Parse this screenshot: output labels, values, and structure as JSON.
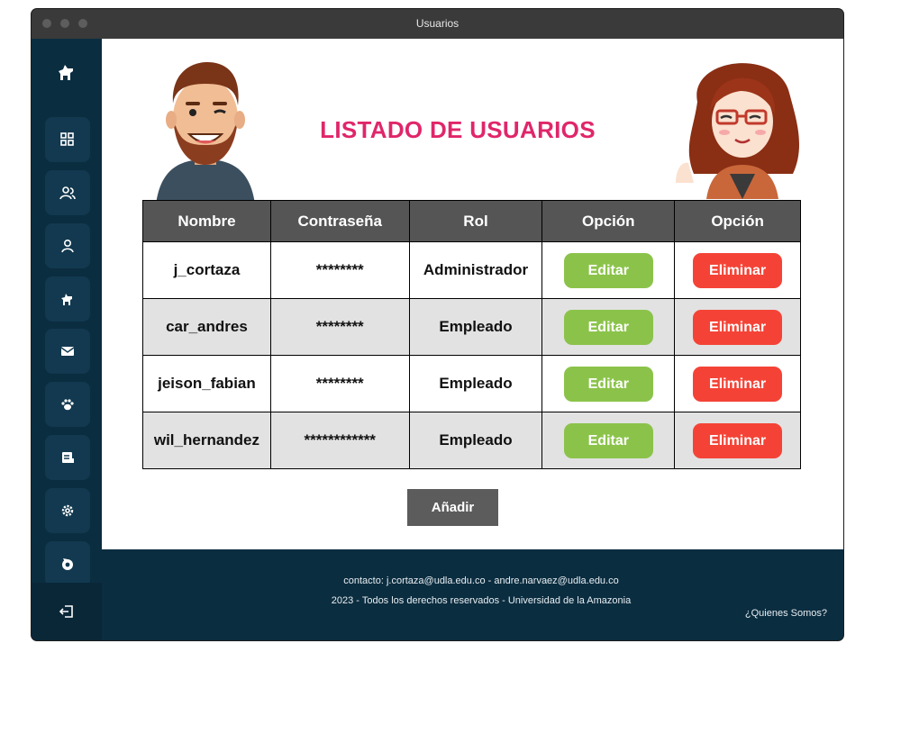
{
  "window": {
    "title": "Usuarios"
  },
  "page": {
    "title": "LISTADO DE USUARIOS"
  },
  "table": {
    "headers": [
      "Nombre",
      "Contraseña",
      "Rol",
      "Opción",
      "Opción"
    ],
    "rows": [
      {
        "name": "j_cortaza",
        "password": "********",
        "role": "Administrador"
      },
      {
        "name": "car_andres",
        "password": "********",
        "role": "Empleado"
      },
      {
        "name": "jeison_fabian",
        "password": "********",
        "role": "Empleado"
      },
      {
        "name": "wil_hernandez",
        "password": "************",
        "role": "Empleado"
      }
    ],
    "edit_label": "Editar",
    "delete_label": "Eliminar"
  },
  "actions": {
    "add_label": "Añadir"
  },
  "footer": {
    "contact": "contacto: j.cortaza@udla.edu.co -  andre.narvaez@udla.edu.co",
    "rights": "2023 - Todos los derechos reservados - Universidad de la Amazonia",
    "about_link": "¿Quienes Somos?"
  },
  "sidebar": {
    "icons": [
      "dog-logo-icon",
      "dashboard-icon",
      "users-icon",
      "user-icon",
      "pet-dog-icon",
      "mail-icon",
      "paw-icon",
      "report-icon",
      "settings-icon",
      "refresh-icon",
      "logout-icon"
    ]
  },
  "colors": {
    "title": "#e0266a",
    "edit": "#8bc34a",
    "delete": "#f44336",
    "sidebar": "#0b2d40",
    "header": "#555555"
  }
}
